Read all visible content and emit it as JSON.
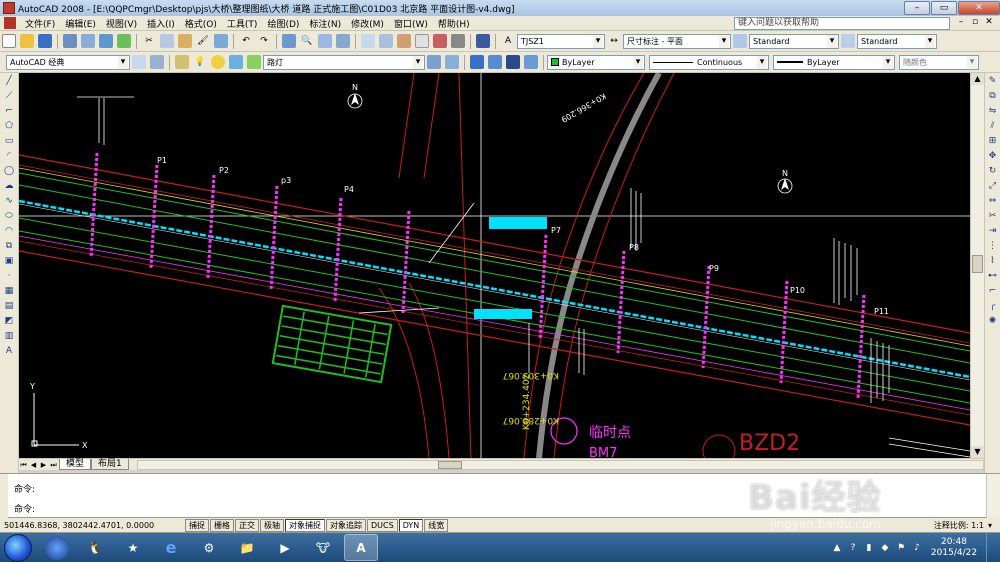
{
  "window": {
    "title": "AutoCAD 2008 - [E:\\QQPCmgr\\Desktop\\pjs\\大桥\\整理图纸\\大桥 道路 正式施工图\\C01D03 北京路 平面设计图-v4.dwg]",
    "min_label": "–",
    "max_label": "▭",
    "close_label": "✕"
  },
  "menu": {
    "items": [
      {
        "label": "文件(F)"
      },
      {
        "label": "编辑(E)"
      },
      {
        "label": "视图(V)"
      },
      {
        "label": "插入(I)"
      },
      {
        "label": "格式(O)"
      },
      {
        "label": "工具(T)"
      },
      {
        "label": "绘图(D)"
      },
      {
        "label": "标注(N)"
      },
      {
        "label": "修改(M)"
      },
      {
        "label": "窗口(W)"
      },
      {
        "label": "帮助(H)"
      }
    ],
    "help_placeholder": "键入问题以获取帮助",
    "mdi_min": "–",
    "mdi_restore": "▫",
    "mdi_close": "✕"
  },
  "toolbar1": {
    "textstyle_value": "TJSZ1",
    "dimstyle_value": "尺寸标注 - 平面",
    "tablestyle_value": "Standard",
    "mlstyle_value": "Standard"
  },
  "toolbar2": {
    "workspace_value": "AutoCAD 经典",
    "layer_value": "路灯",
    "color_value": "ByLayer",
    "linetype_value": "Continuous",
    "lineweight_value": "ByLayer",
    "plotstyle_value": "随颜色"
  },
  "drawing": {
    "labels": {
      "p1": "P1",
      "p2": "P2",
      "p3": "p3",
      "p4": "P4",
      "p7": "P7",
      "p8": "P8",
      "p9": "P9",
      "p10": "P10",
      "p11": "P11",
      "north": "N",
      "k0_top": "K0+366.209",
      "k0_bot1": "K0+303.067",
      "k0_bot2": "K0+288.067",
      "k0_bot3": "K0+234.402",
      "temp_point": "临时点",
      "bm": "BM7",
      "bzd": "BZD2",
      "ucs_y": "Y",
      "ucs_x": "X"
    },
    "colors": {
      "road_edge": "#c81e1e",
      "green_line": "#20c020",
      "cyan": "#00e0ff",
      "magenta": "#ff30ff",
      "white": "#ffffff",
      "yellow": "#e0e000"
    }
  },
  "tabs": {
    "model": "模型",
    "layout1": "布局1"
  },
  "command": {
    "line1": "命令:",
    "line2": "命令:"
  },
  "status": {
    "coords": "501446.8368, 3802442.4701, 0.0000",
    "buttons": [
      {
        "label": "捕捉",
        "on": false
      },
      {
        "label": "栅格",
        "on": false
      },
      {
        "label": "正交",
        "on": false
      },
      {
        "label": "极轴",
        "on": false
      },
      {
        "label": "对象捕捉",
        "on": true
      },
      {
        "label": "对象追踪",
        "on": false
      },
      {
        "label": "DUCS",
        "on": false
      },
      {
        "label": "DYN",
        "on": true
      },
      {
        "label": "线宽",
        "on": false
      }
    ],
    "annotation_scale": "注释比例: 1:1"
  },
  "taskbar": {
    "time": "20:48",
    "date": "2015/4/22"
  },
  "watermark": {
    "brand": "Bai经验",
    "url": "jingyan.baidu.com"
  }
}
